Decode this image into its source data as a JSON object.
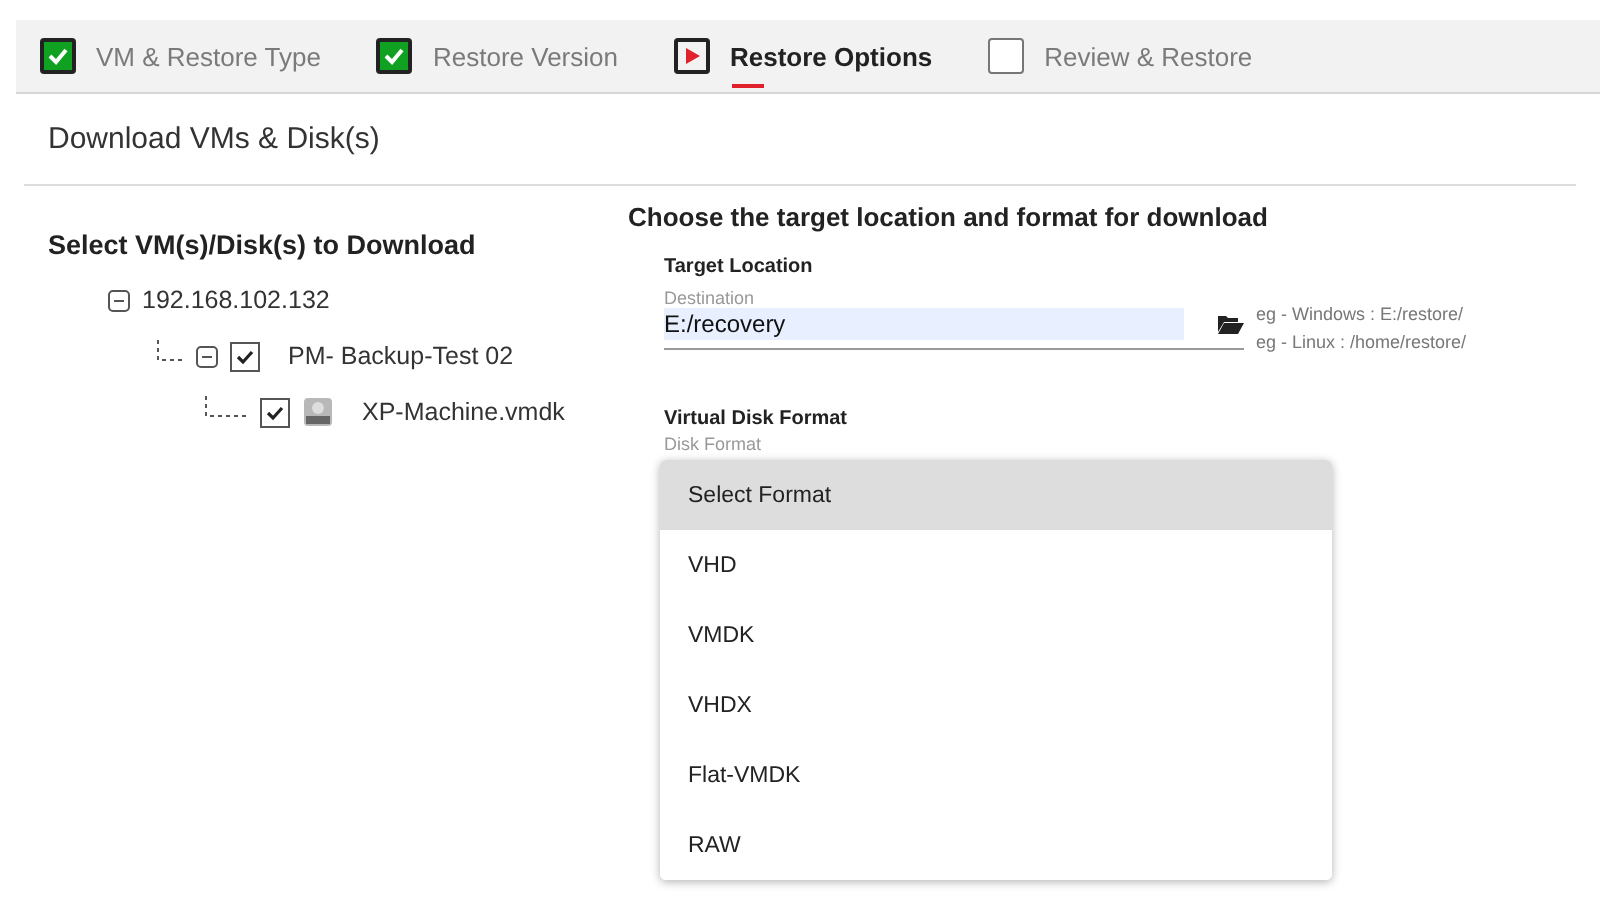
{
  "steps": [
    {
      "label": "VM & Restore Type",
      "kind": "done",
      "selected": false
    },
    {
      "label": "Restore Version",
      "kind": "done",
      "selected": false
    },
    {
      "label": "Restore Options",
      "kind": "current",
      "selected": true
    },
    {
      "label": "Review & Restore",
      "kind": "pending",
      "selected": false
    }
  ],
  "page_title": "Download VMs & Disk(s)",
  "tree": {
    "heading": "Select VM(s)/Disk(s) to Download",
    "items": [
      {
        "label": "192.168.102.132",
        "kind": "host",
        "expanded": true,
        "children": [
          {
            "label": "PM- Backup-Test 02",
            "kind": "vm",
            "expanded": true,
            "checked": true,
            "children": [
              {
                "label": "XP-Machine.vmdk",
                "kind": "disk",
                "checked": true
              }
            ]
          }
        ]
      }
    ]
  },
  "options": {
    "heading": "Choose the target location and format for download",
    "target": {
      "section": "Target Location",
      "label": "Destination",
      "value": "E:/recovery",
      "hints": [
        "eg - Windows : E:/restore/",
        "eg - Linux : /home/restore/"
      ]
    },
    "format": {
      "section": "Virtual Disk Format",
      "label": "Disk Format",
      "options": [
        {
          "label": "Select Format",
          "selected": true
        },
        {
          "label": "VHD",
          "selected": false
        },
        {
          "label": "VMDK",
          "selected": false
        },
        {
          "label": "VHDX",
          "selected": false
        },
        {
          "label": "Flat-VMDK",
          "selected": false
        },
        {
          "label": "RAW",
          "selected": false
        }
      ]
    }
  }
}
